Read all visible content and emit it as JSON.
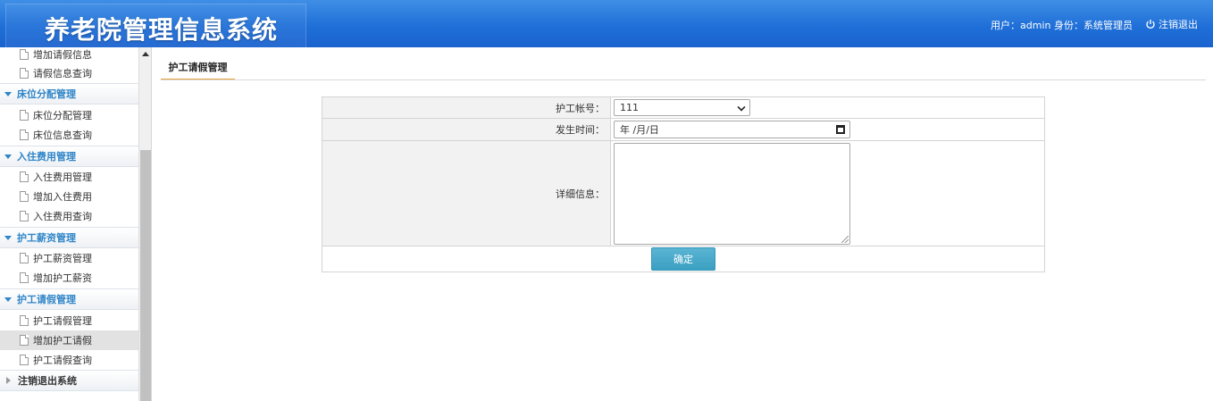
{
  "header": {
    "title": "养老院管理信息系统",
    "user_info": "用户：admin 身份：系统管理员",
    "logout_label": "注销退出"
  },
  "sidebar": {
    "groups": [
      {
        "label": "床位分配管理",
        "items": [
          "床位分配管理",
          "床位信息查询"
        ]
      },
      {
        "label": "入住费用管理",
        "items": [
          "入住费用管理",
          "增加入住费用",
          "入住费用查询"
        ]
      },
      {
        "label": "护工薪资管理",
        "items": [
          "护工薪资管理",
          "增加护工薪资"
        ]
      },
      {
        "label": "护工请假管理",
        "items": [
          "护工请假管理",
          "增加护工请假",
          "护工请假查询"
        ]
      }
    ],
    "top_items": [
      "增加请假信息",
      "请假信息查询"
    ],
    "bottom_group": "注销退出系统",
    "active_item": "增加护工请假"
  },
  "main": {
    "tab_label": "护工请假管理",
    "form": {
      "nurse_account_label": "护工帐号：",
      "nurse_account_value": "111",
      "time_label": "发生时间：",
      "time_placeholder": "年 /月/日",
      "detail_label": "详细信息：",
      "submit_label": "确定"
    }
  }
}
